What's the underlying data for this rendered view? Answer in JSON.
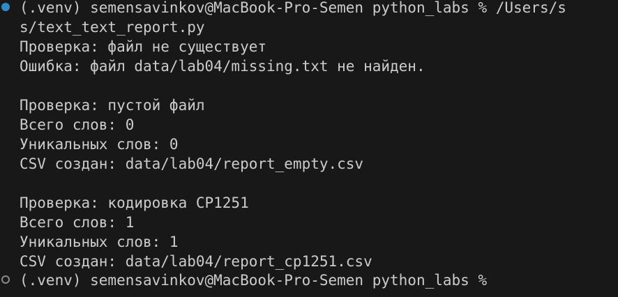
{
  "terminal": {
    "first_command": {
      "prompt": "(.venv) semensavinkov@MacBook-Pro-Semen python_labs % ",
      "command_start": "/Users/s",
      "command_wrap": "s/text_text_report.py"
    },
    "output": [
      "Проверка: файл не существует",
      "Ошибка: файл data/lab04/missing.txt не найден.",
      "",
      "Проверка: пустой файл",
      "Всего слов: 0",
      "Уникальных слов: 0",
      "CSV создан: data/lab04/report_empty.csv",
      "",
      "Проверка: кодировка CP1251",
      "Всего слов: 1",
      "Уникальных слов: 1",
      "CSV создан: data/lab04/report_cp1251.csv"
    ],
    "last_prompt": "(.venv) semensavinkov@MacBook-Pro-Semen python_labs %",
    "colors": {
      "background": "#181818",
      "text": "#cccccc",
      "success_marker": "#2f8ac8",
      "idle_marker": "#8a8a8a"
    }
  }
}
